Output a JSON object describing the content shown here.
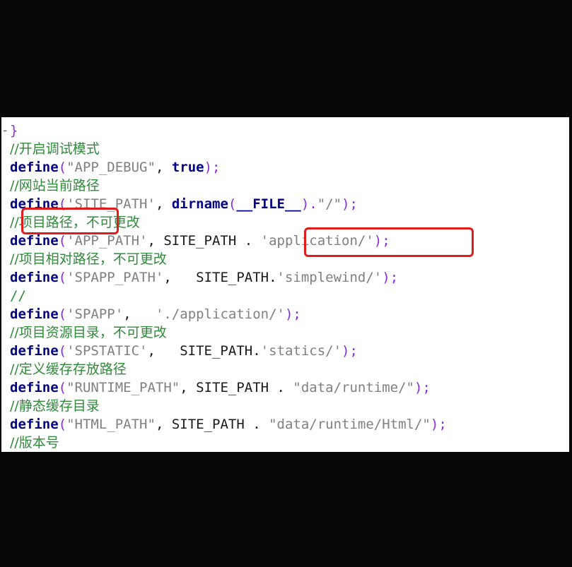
{
  "editor": {
    "gutter_mark": "-",
    "lines": [
      {
        "id": "l0",
        "parts": [
          {
            "t": "}",
            "c": "pun"
          }
        ]
      },
      {
        "id": "l1",
        "parts": [
          {
            "t": "//开启调试模式",
            "c": "cmt"
          }
        ]
      },
      {
        "id": "l2",
        "parts": [
          {
            "t": "define",
            "c": "kw"
          },
          {
            "t": "(",
            "c": "pun"
          },
          {
            "t": "\"APP_DEBUG\"",
            "c": "str"
          },
          {
            "t": ", ",
            "c": "txt"
          },
          {
            "t": "true",
            "c": "kw"
          },
          {
            "t": ");",
            "c": "pun"
          }
        ]
      },
      {
        "id": "l3",
        "parts": [
          {
            "t": "//网站当前路径",
            "c": "cmt"
          }
        ]
      },
      {
        "id": "l4",
        "parts": [
          {
            "t": "define",
            "c": "kw"
          },
          {
            "t": "(",
            "c": "pun"
          },
          {
            "t": "'SITE_PATH'",
            "c": "str"
          },
          {
            "t": ", ",
            "c": "txt"
          },
          {
            "t": "dirname",
            "c": "kw"
          },
          {
            "t": "(",
            "c": "pun"
          },
          {
            "t": "__FILE__",
            "c": "kw"
          },
          {
            "t": ").",
            "c": "pun"
          },
          {
            "t": "\"/\"",
            "c": "str"
          },
          {
            "t": ");",
            "c": "pun"
          }
        ]
      },
      {
        "id": "l5",
        "parts": [
          {
            "t": "//项目路径，不可更改",
            "c": "cmt"
          }
        ]
      },
      {
        "id": "l6",
        "parts": [
          {
            "t": "define",
            "c": "kw"
          },
          {
            "t": "(",
            "c": "pun"
          },
          {
            "t": "'APP_PATH'",
            "c": "str"
          },
          {
            "t": ", SITE_PATH . ",
            "c": "txt"
          },
          {
            "t": "'application/'",
            "c": "str"
          },
          {
            "t": ");",
            "c": "pun"
          }
        ]
      },
      {
        "id": "l7",
        "parts": [
          {
            "t": "//项目相对路径，不可更改",
            "c": "cmt"
          }
        ]
      },
      {
        "id": "l8",
        "parts": [
          {
            "t": "define",
            "c": "kw"
          },
          {
            "t": "(",
            "c": "pun"
          },
          {
            "t": "'SPAPP_PATH'",
            "c": "str"
          },
          {
            "t": ",   SITE_PATH.",
            "c": "txt"
          },
          {
            "t": "'simplewind/'",
            "c": "str"
          },
          {
            "t": ");",
            "c": "pun"
          }
        ]
      },
      {
        "id": "l9",
        "parts": [
          {
            "t": "//",
            "c": "cmt"
          }
        ]
      },
      {
        "id": "l10",
        "parts": [
          {
            "t": "define",
            "c": "kw"
          },
          {
            "t": "(",
            "c": "pun"
          },
          {
            "t": "'SPAPP'",
            "c": "str"
          },
          {
            "t": ",   ",
            "c": "txt"
          },
          {
            "t": "'./application/'",
            "c": "str"
          },
          {
            "t": ");",
            "c": "pun"
          }
        ]
      },
      {
        "id": "l11",
        "parts": [
          {
            "t": "//项目资源目录，不可更改",
            "c": "cmt"
          }
        ]
      },
      {
        "id": "l12",
        "parts": [
          {
            "t": "define",
            "c": "kw"
          },
          {
            "t": "(",
            "c": "pun"
          },
          {
            "t": "'SPSTATIC'",
            "c": "str"
          },
          {
            "t": ",   SITE_PATH.",
            "c": "txt"
          },
          {
            "t": "'statics/'",
            "c": "str"
          },
          {
            "t": ");",
            "c": "pun"
          }
        ]
      },
      {
        "id": "l13",
        "parts": [
          {
            "t": "//定义缓存存放路径",
            "c": "cmt"
          }
        ]
      },
      {
        "id": "l14",
        "parts": [
          {
            "t": "define",
            "c": "kw"
          },
          {
            "t": "(",
            "c": "pun"
          },
          {
            "t": "\"RUNTIME_PATH\"",
            "c": "str"
          },
          {
            "t": ", SITE_PATH . ",
            "c": "txt"
          },
          {
            "t": "\"data/runtime/\"",
            "c": "str"
          },
          {
            "t": ");",
            "c": "pun"
          }
        ]
      },
      {
        "id": "l15",
        "parts": [
          {
            "t": "//静态缓存目录",
            "c": "cmt"
          }
        ]
      },
      {
        "id": "l16",
        "parts": [
          {
            "t": "define",
            "c": "kw"
          },
          {
            "t": "(",
            "c": "pun"
          },
          {
            "t": "\"HTML_PATH\"",
            "c": "str"
          },
          {
            "t": ", SITE_PATH . ",
            "c": "txt"
          },
          {
            "t": "\"data/runtime/Html/\"",
            "c": "str"
          },
          {
            "t": ");",
            "c": "pun"
          }
        ]
      },
      {
        "id": "l17",
        "parts": [
          {
            "t": "//版本号",
            "c": "cmt"
          }
        ]
      }
    ]
  },
  "colors": {
    "background": "#060607",
    "editor_bg": "#ffffff",
    "comment": "#2e8b3a",
    "keyword": "#00008b",
    "punct": "#8a2be2",
    "string": "#808080",
    "highlight": "#e11b1b"
  }
}
